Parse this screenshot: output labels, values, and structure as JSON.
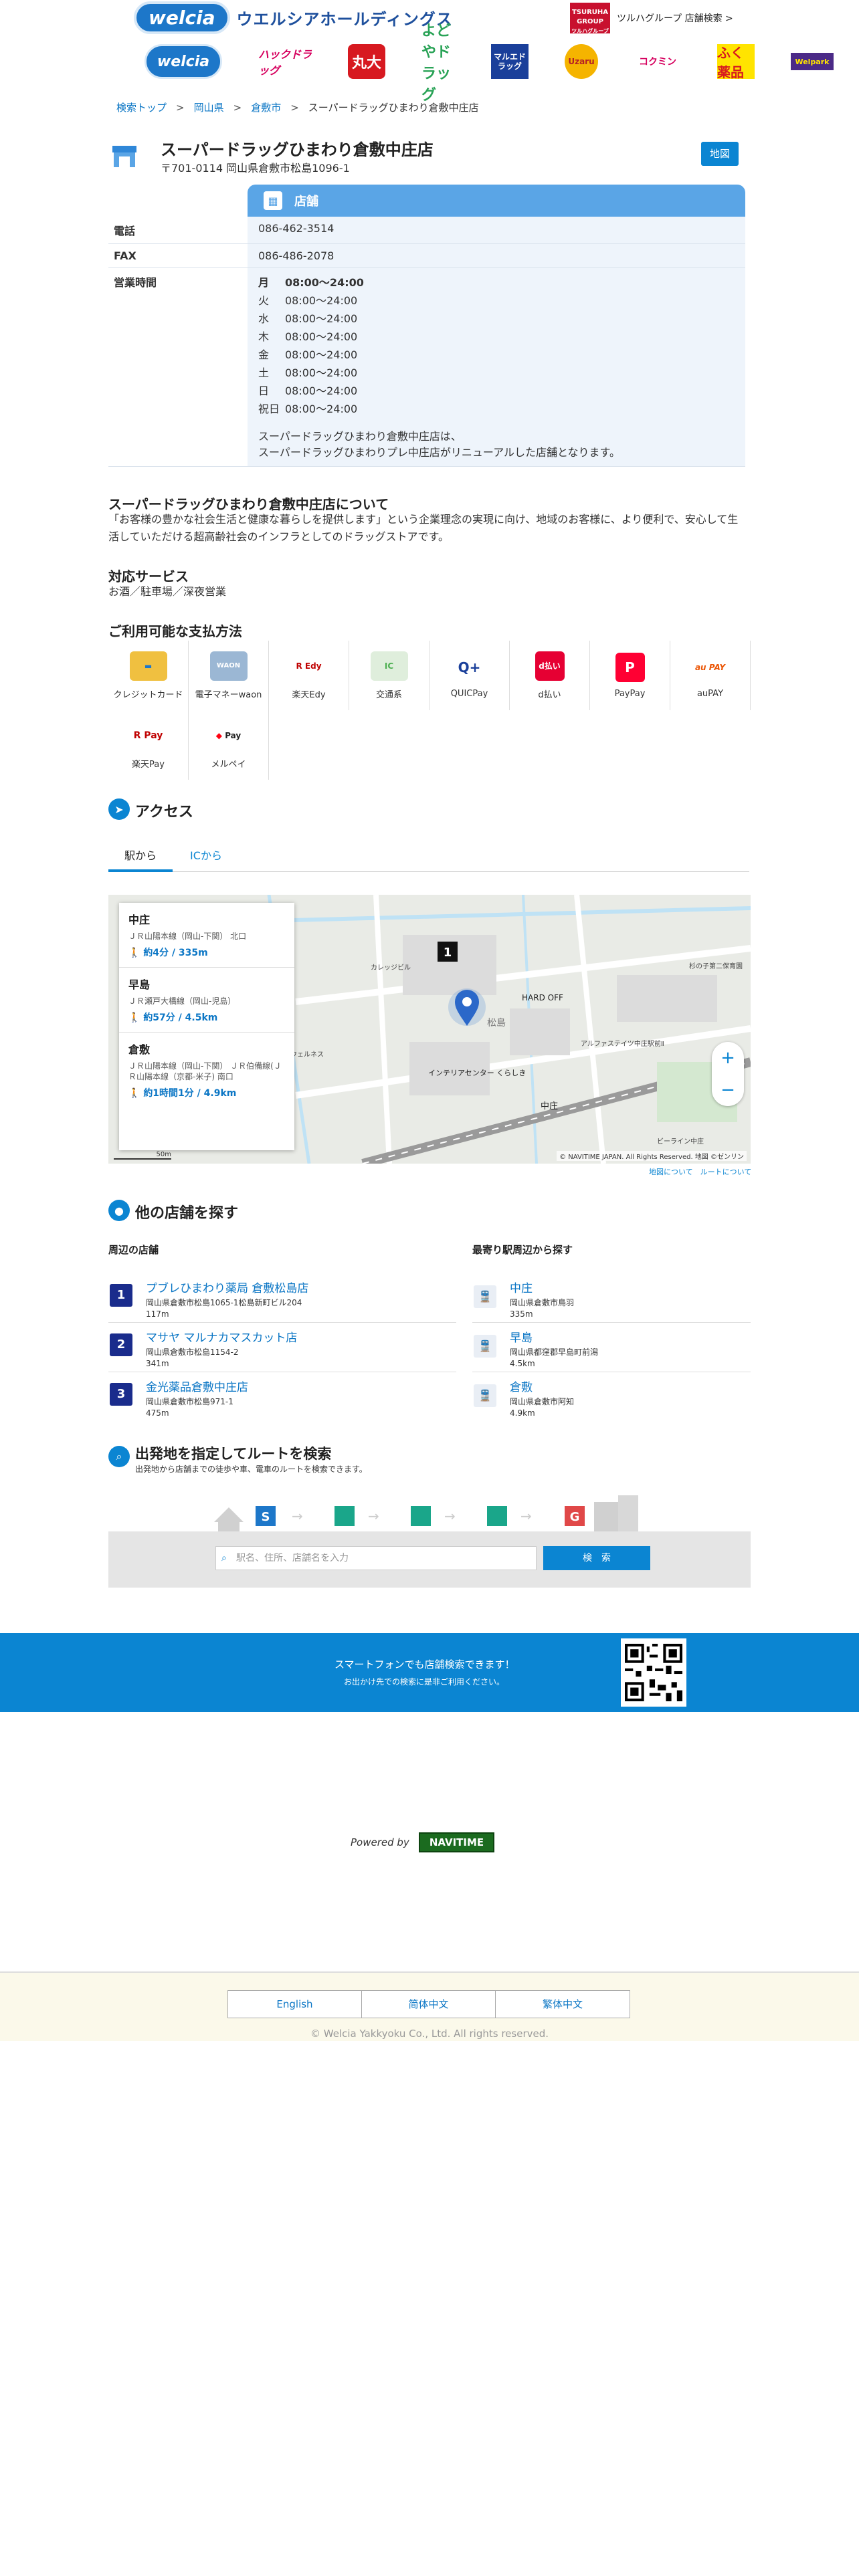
{
  "header": {
    "logo": "welcia",
    "holdings": "ウエルシアホールディングス",
    "tsuruha_logo": "TSURUHA GROUP",
    "tsuruha_sub": "ツルハグループ",
    "tsuruha_link": "ツルハグループ 店舗検索 >",
    "brands": [
      "welcia",
      "ハックドラッグ",
      "丸大",
      "よどやドラッグ",
      "マルエドラッグ",
      "Uzaru",
      "コクミン",
      "ふく薬品",
      "Welpark"
    ]
  },
  "breadcrumb": [
    "検索トップ",
    "岡山県",
    "倉敷市",
    "スーパードラッグひまわり倉敷中庄店"
  ],
  "store": {
    "name": "スーパードラッグひまわり倉敷中庄店",
    "address": "〒701-0114 岡山県倉敷市松島1096-1",
    "map_button": "地図",
    "tab_label": "店舗",
    "phone_label": "電話",
    "phone": "086-462-3514",
    "fax_label": "FAX",
    "fax": "086-486-2078",
    "hours_label": "営業時間",
    "hours": [
      {
        "day": "月",
        "time": "08:00〜24:00"
      },
      {
        "day": "火",
        "time": "08:00〜24:00"
      },
      {
        "day": "水",
        "time": "08:00〜24:00"
      },
      {
        "day": "木",
        "time": "08:00〜24:00"
      },
      {
        "day": "金",
        "time": "08:00〜24:00"
      },
      {
        "day": "土",
        "time": "08:00〜24:00"
      },
      {
        "day": "日",
        "time": "08:00〜24:00"
      },
      {
        "day": "祝日",
        "time": "08:00〜24:00"
      }
    ],
    "note_1": "スーパードラッグひまわり倉敷中庄店は、",
    "note_2": "スーパードラッグひまわりプレ中庄店がリニューアルした店舗となります。"
  },
  "about": {
    "title": "スーパードラッグひまわり倉敷中庄店について",
    "text": "「お客様の豊かな社会生活と健康な暮らしを提供します」という企業理念の実現に向け、地域のお客様に、より便利で、安心して生活していただける超高齢社会のインフラとしてのドラッグストアです。"
  },
  "services": {
    "title": "対応サービス",
    "text": "お酒／駐車場／深夜営業"
  },
  "payments": {
    "title": "ご利用可能な支払方法",
    "items": [
      {
        "label": "クレジットカード",
        "icon": "credit-card-icon",
        "mark": "💳",
        "color": "#f0c040"
      },
      {
        "label": "電子マネーwaon",
        "icon": "waon-icon",
        "mark": "WAON",
        "color": "#9bb7d4"
      },
      {
        "label": "楽天Edy",
        "icon": "rakuten-edy-icon",
        "mark": "R Edy",
        "color": "#ffffff"
      },
      {
        "label": "交通系",
        "icon": "transit-card-icon",
        "mark": "IC",
        "color": "#8bc34a"
      },
      {
        "label": "QUICPay",
        "icon": "quicpay-icon",
        "mark": "Q+",
        "color": "#ffffff"
      },
      {
        "label": "d払い",
        "icon": "d-barai-icon",
        "mark": "d払い",
        "color": "#e60033"
      },
      {
        "label": "PayPay",
        "icon": "paypay-icon",
        "mark": "P",
        "color": "#ff0033"
      },
      {
        "label": "auPAY",
        "icon": "aupay-icon",
        "mark": "au PAY",
        "color": "#ffffff"
      },
      {
        "label": "楽天Pay",
        "icon": "rakuten-pay-icon",
        "mark": "R Pay",
        "color": "#ffffff"
      },
      {
        "label": "メルペイ",
        "icon": "merpay-icon",
        "mark": "Pay",
        "color": "#ffffff"
      }
    ]
  },
  "access": {
    "title": "アクセス",
    "tab_station": "駅から",
    "tab_ic": "ICから",
    "stations": [
      {
        "name": "中庄",
        "line": "ＪＲ山陽本線（岡山-下関） 北口",
        "walk": "約4分 / 335m"
      },
      {
        "name": "早島",
        "line": "ＪＲ瀬戸大橋線（岡山-児島）",
        "walk": "約57分 / 4.5km"
      },
      {
        "name": "倉敷",
        "line": "ＪＲ山陽本線（岡山-下関） ＪＲ伯備線(ＪＲ山陽本線（京都-米子) 南口",
        "walk": "約1時間1分 / 4.9km"
      }
    ],
    "map_labels": {
      "hardoff": "HARD OFF",
      "matsushima": "松島",
      "interior": "インテリアセンター くらしき",
      "nakasho": "中庄",
      "karesi": "カレッジビル",
      "alpha": "アルファステイツ中庄駅前Ⅱ",
      "nursery": "杉の子第二保育園",
      "wellness": "ウェルネス",
      "bilan": "ビーライン中庄",
      "route_marker": "1"
    },
    "map_copyright": "© NAVITIME JAPAN. All Rights Reserved. 地図 ©ゼンリン",
    "map_scale": "50m",
    "map_links": "地図について　ルートについて",
    "zoom_in": "+",
    "zoom_out": "−"
  },
  "other": {
    "title": "他の店舗を探す",
    "nearby_title": "周辺の店舗",
    "stations_title": "最寄り駅周辺から探す",
    "nearby": [
      {
        "num": "1",
        "name": "プブレひまわり薬局 倉敷松島店",
        "addr": "岡山県倉敷市松島1065-1松島新町ビル204",
        "dist": "117m"
      },
      {
        "num": "2",
        "name": "マサヤ マルナカマスカット店",
        "addr": "岡山県倉敷市松島1154-2",
        "dist": "341m"
      },
      {
        "num": "3",
        "name": "金光薬品倉敷中庄店",
        "addr": "岡山県倉敷市松島971-1",
        "dist": "475m"
      }
    ],
    "stations": [
      {
        "name": "中庄",
        "addr": "岡山県倉敷市鳥羽",
        "dist": "335m"
      },
      {
        "name": "早島",
        "addr": "岡山県都窪郡早島町前潟",
        "dist": "4.5km"
      },
      {
        "name": "倉敷",
        "addr": "岡山県倉敷市阿知",
        "dist": "4.9km"
      }
    ]
  },
  "route": {
    "title": "出発地を指定してルートを検索",
    "subtitle": "出発地から店舗までの徒歩や車、電車のルートを検索できます。",
    "placeholder": "駅名、住所、店舗名を入力",
    "button": "検　索",
    "start": "S",
    "goal": "G"
  },
  "band": {
    "text1": "スマートフォンでも店舗検索できます！",
    "text2": "お出かけ先での検索に是非ご利用ください。"
  },
  "powered": {
    "label": "Powered by",
    "brand": "NAVITIME"
  },
  "footer": {
    "langs": [
      "English",
      "简体中文",
      "繁体中文"
    ],
    "copyright": "© Welcia Yakkyoku Co., Ltd. All rights reserved."
  }
}
